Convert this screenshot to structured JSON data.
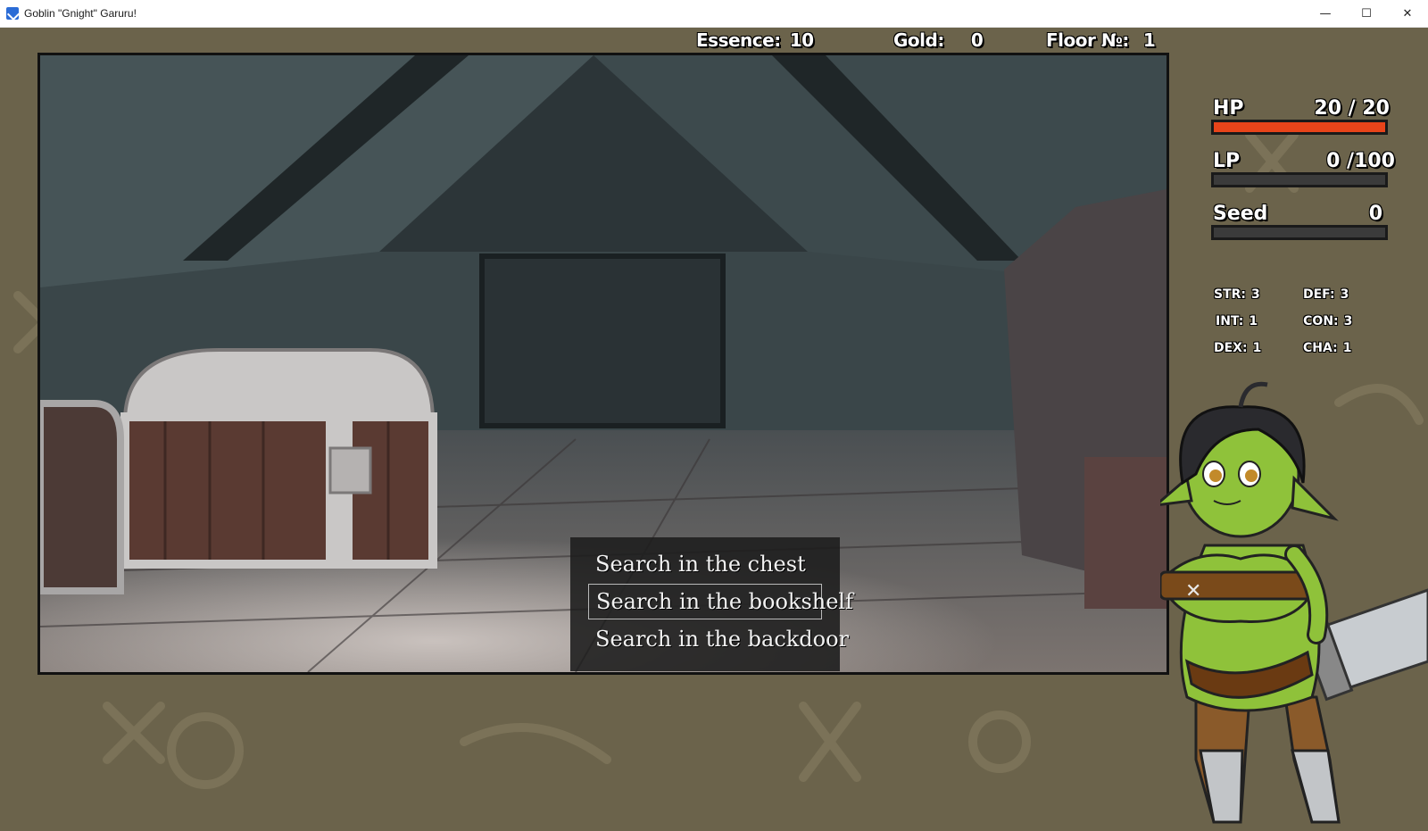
{
  "window": {
    "title": "Goblin \"Gnight\" Garuru!",
    "minimize": "—",
    "maximize": "☐",
    "close": "✕"
  },
  "hud": {
    "essence_label": "Essence:",
    "essence_value": "10",
    "gold_label": "Gold:",
    "gold_value": "0",
    "floor_label": "Floor №:",
    "floor_value": "1"
  },
  "bars": {
    "hp": {
      "label": "HP",
      "value": "20 / 20",
      "fraction": 1.0,
      "color": "#e8441a"
    },
    "lp": {
      "label": "LP",
      "value": "0  /100",
      "fraction": 0.0,
      "color": "#c23a9a"
    },
    "seed": {
      "label": "Seed",
      "value": "0",
      "fraction": 0.0,
      "color": "#e8e8e8"
    }
  },
  "stats": {
    "str_label": "STR:",
    "str_value": "3",
    "def_label": "DEF:",
    "def_value": "3",
    "int_label": "INT:",
    "int_value": "1",
    "con_label": "CON:",
    "con_value": "3",
    "dex_label": "DEX:",
    "dex_value": "1",
    "cha_label": "CHA:",
    "cha_value": "1"
  },
  "choices": [
    {
      "label": "Search in the chest"
    },
    {
      "label": "Search in the bookshelf"
    },
    {
      "label": "Search in the backdoor"
    }
  ],
  "colors": {
    "background": "#6b634b",
    "hp_bar": "#e8441a",
    "menu_bg": "#1c1c1c"
  }
}
